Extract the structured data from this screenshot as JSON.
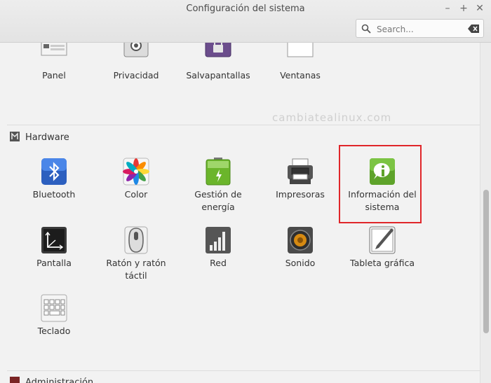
{
  "window": {
    "title": "Configuración del sistema",
    "minimize_glyph": "–",
    "maximize_glyph": "+",
    "close_glyph": "✕"
  },
  "search": {
    "placeholder": "Search..."
  },
  "watermark": "cambiatealinux.com",
  "top_row": [
    {
      "label": "Panel",
      "icon": "panel-icon"
    },
    {
      "label": "Privacidad",
      "icon": "privacy-icon"
    },
    {
      "label": "Salvapantallas",
      "icon": "screensaver-lock-icon"
    },
    {
      "label": "Ventanas",
      "icon": "windows-icon"
    }
  ],
  "hardware": {
    "title": "Hardware",
    "items": [
      {
        "label": "Bluetooth",
        "icon": "bluetooth-icon"
      },
      {
        "label": "Color",
        "icon": "color-icon"
      },
      {
        "label": "Gestión de energía",
        "icon": "battery-icon"
      },
      {
        "label": "Impresoras",
        "icon": "printer-icon"
      },
      {
        "label": "Información del sistema",
        "icon": "system-info-icon",
        "highlighted": true
      },
      {
        "label": "Pantalla",
        "icon": "display-icon"
      },
      {
        "label": "Ratón y ratón táctil",
        "icon": "mouse-icon"
      },
      {
        "label": "Red",
        "icon": "network-icon"
      },
      {
        "label": "Sonido",
        "icon": "speaker-icon"
      },
      {
        "label": "Tableta gráfica",
        "icon": "tablet-icon"
      },
      {
        "label": "Teclado",
        "icon": "keyboard-icon"
      }
    ]
  },
  "next_section": {
    "title": "Administración"
  },
  "colors": {
    "highlight": "#e0262a",
    "accent_green": "#6bb52b"
  }
}
